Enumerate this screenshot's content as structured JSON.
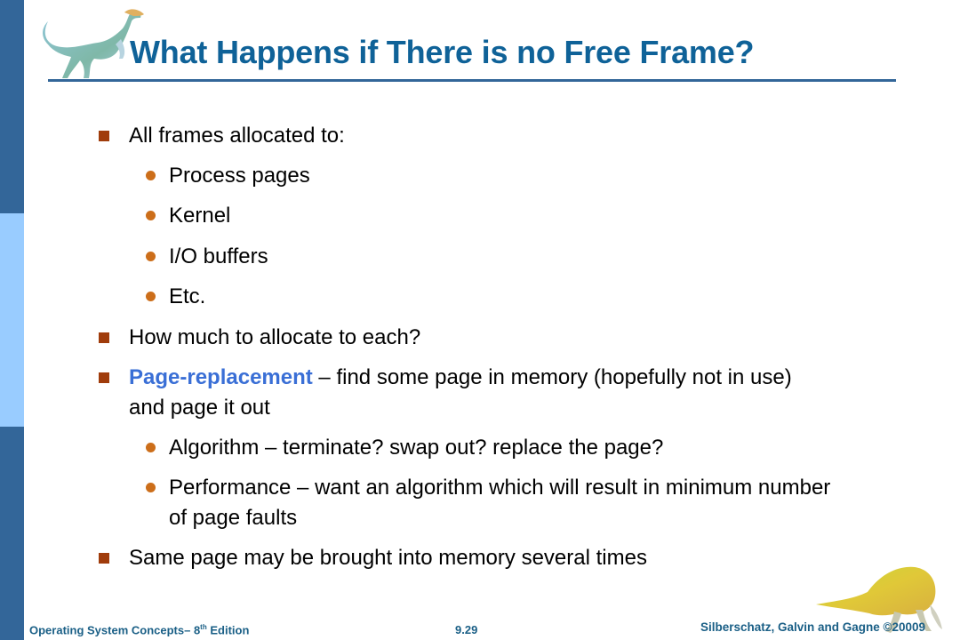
{
  "slide": {
    "title": "What Happens if There is no Free Frame?",
    "colors": {
      "title": "#0f6298",
      "sidebar_dark": "#336699",
      "sidebar_light": "#99ccff",
      "square_bullet": "#a03c0b",
      "round_bullet": "#cc6e1a",
      "highlight": "#3a6fd6",
      "footer": "#1a5f86"
    },
    "bullets": [
      {
        "text": "All frames allocated to:",
        "children": [
          "Process pages",
          "Kernel",
          "I/O buffers",
          "Etc."
        ]
      },
      {
        "text": "How much to allocate to each?"
      },
      {
        "highlight": "Page-replacement",
        "text_rest_line1": " – find some page in memory (hopefully not in use)",
        "text_line2": "and page it out",
        "children": [
          {
            "line1": "Algorithm – terminate? swap out? replace the page?"
          },
          {
            "line1": "Performance – want an algorithm which will result in minimum number",
            "line2": "of page faults"
          }
        ]
      },
      {
        "text": "Same page may be brought into memory several times"
      }
    ]
  },
  "footer": {
    "book_prefix": "Operating System Concepts– 8",
    "book_sup": "th",
    "book_suffix": " Edition",
    "page_number": "9.29",
    "copyright": "Silberschatz, Galvin and Gagne ©20009"
  },
  "images": {
    "top_left": "dinosaur-blue-icon",
    "bottom_right": "dinosaur-yellow-icon"
  }
}
